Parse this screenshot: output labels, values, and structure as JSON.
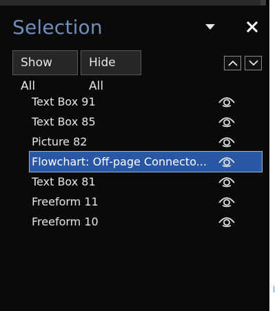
{
  "pane": {
    "title": "Selection",
    "dropdown_icon": "triangle-down-icon",
    "close_icon": "close-icon"
  },
  "toolbar": {
    "show_all_label": "Show All",
    "hide_all_label": "Hide All",
    "move_up_icon": "chevron-up-icon",
    "move_down_icon": "chevron-down-icon"
  },
  "objects": [
    {
      "label": "Text Box 91",
      "visible": true,
      "selected": false
    },
    {
      "label": "Text Box 85",
      "visible": true,
      "selected": false
    },
    {
      "label": "Picture 82",
      "visible": true,
      "selected": false
    },
    {
      "label": "Flowchart: Off-page Connecto...",
      "visible": true,
      "selected": true
    },
    {
      "label": "Text Box 81",
      "visible": true,
      "selected": false
    },
    {
      "label": "Freeform 11",
      "visible": true,
      "selected": false
    },
    {
      "label": "Freeform 10",
      "visible": true,
      "selected": false
    }
  ],
  "colors": {
    "title": "#6f8fbf",
    "selection_bg": "#2a57a3",
    "pane_bg": "#0a0a0a"
  }
}
